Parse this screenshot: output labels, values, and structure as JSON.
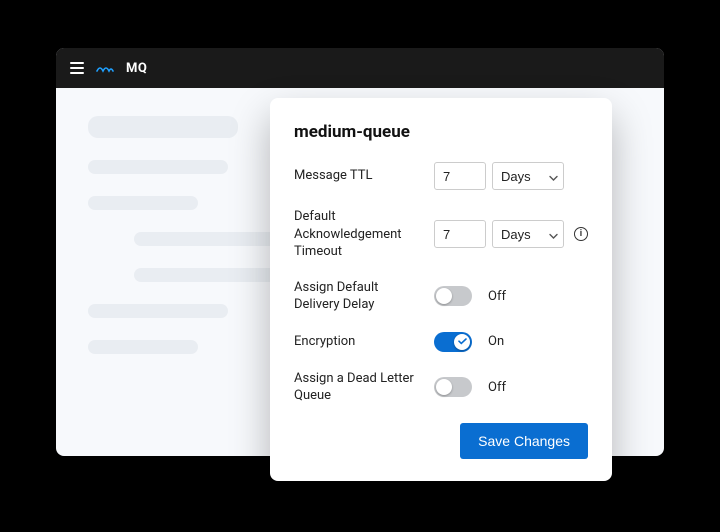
{
  "header": {
    "app_name": "MQ"
  },
  "panel": {
    "title": "medium-queue",
    "settings": {
      "message_ttl": {
        "label": "Message TTL",
        "value": "7",
        "unit": "Days"
      },
      "ack_timeout": {
        "label": "Default Acknowledgement Timeout",
        "value": "7",
        "unit": "Days"
      },
      "delivery_delay": {
        "label": "Assign Default Delivery Delay",
        "state": "Off"
      },
      "encryption": {
        "label": "Encryption",
        "state": "On"
      },
      "dlq": {
        "label": "Assign a Dead Letter Queue",
        "state": "Off"
      }
    },
    "save_label": "Save Changes"
  }
}
